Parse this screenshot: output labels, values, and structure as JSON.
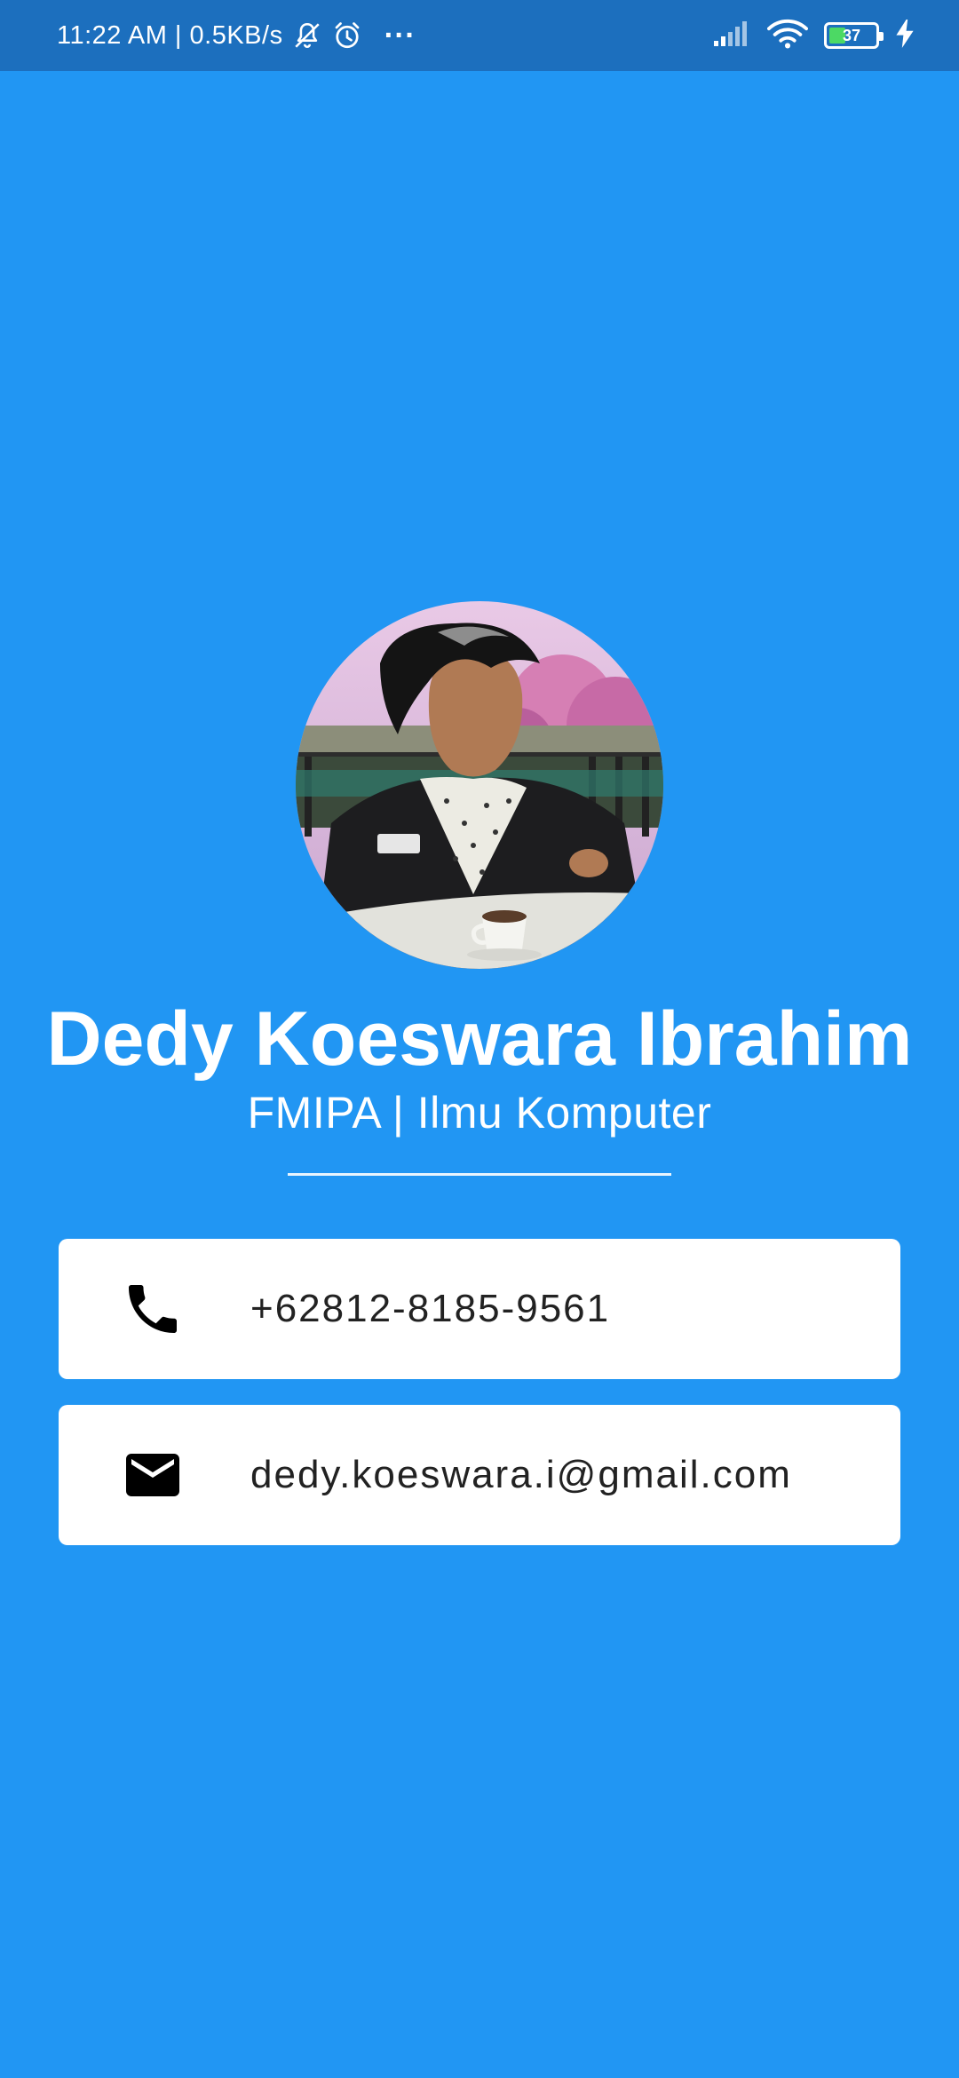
{
  "status_bar": {
    "time_speed": "11:22 AM | 0.5KB/s",
    "more": "···",
    "battery_level": "37",
    "battery_fill_percent": 37
  },
  "profile": {
    "name": "Dedy Koeswara Ibrahim",
    "subtitle": "FMIPA | Ilmu Komputer"
  },
  "contacts": {
    "phone": "+62812-8185-9561",
    "email": "dedy.koeswara.i@gmail.com"
  },
  "colors": {
    "background": "#2196F3",
    "status_bar": "#1C6FBE",
    "card": "#FFFFFF",
    "text_dark": "#222222"
  }
}
